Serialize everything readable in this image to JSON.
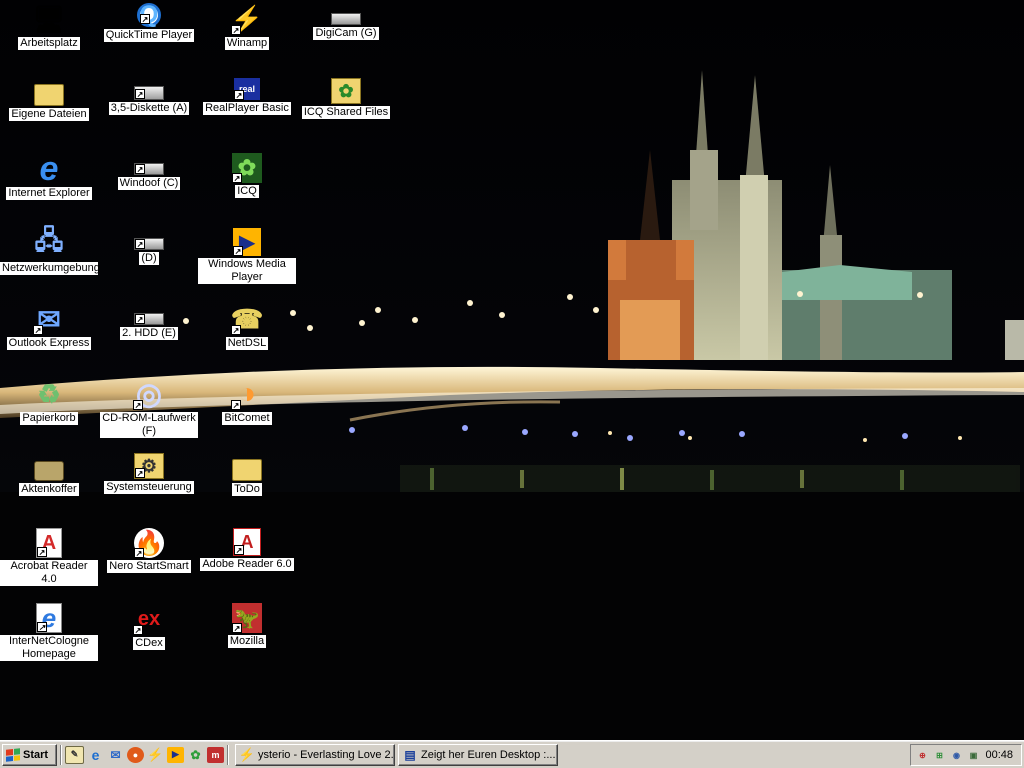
{
  "desktop": {
    "icons": [
      {
        "label": "Arbeitsplatz",
        "icon": "my-computer-icon",
        "shortcut": false
      },
      {
        "label": "QuickTime Player",
        "icon": "quicktime-icon",
        "shortcut": true
      },
      {
        "label": "Winamp",
        "icon": "winamp-icon",
        "shortcut": true
      },
      {
        "label": "DigiCam (G)",
        "icon": "drive-icon",
        "shortcut": false
      },
      {
        "label": "Eigene Dateien",
        "icon": "folder-icon",
        "shortcut": false
      },
      {
        "label": "3,5-Diskette (A)",
        "icon": "floppy-icon",
        "shortcut": true
      },
      {
        "label": "RealPlayer Basic",
        "icon": "realplayer-icon",
        "shortcut": true
      },
      {
        "label": "ICQ Shared Files",
        "icon": "folder-flower-icon",
        "shortcut": false
      },
      {
        "label": "Internet Explorer",
        "icon": "internet-explorer-icon",
        "shortcut": false
      },
      {
        "label": "Windoof (C)",
        "icon": "drive-icon",
        "shortcut": true
      },
      {
        "label": "ICQ",
        "icon": "icq-icon",
        "shortcut": true
      },
      {
        "label": "Netzwerkumgebung",
        "icon": "network-icon",
        "shortcut": false
      },
      {
        "label": "(D)",
        "icon": "drive-icon",
        "shortcut": true
      },
      {
        "label": "Windows Media Player",
        "icon": "media-player-icon",
        "shortcut": true
      },
      {
        "label": "Outlook Express",
        "icon": "outlook-icon",
        "shortcut": true
      },
      {
        "label": "2. HDD (E)",
        "icon": "drive-icon",
        "shortcut": true
      },
      {
        "label": "NetDSL",
        "icon": "phone-icon",
        "shortcut": true
      },
      {
        "label": "Papierkorb",
        "icon": "recycle-bin-icon",
        "shortcut": false
      },
      {
        "label": "CD-ROM-Laufwerk (F)",
        "icon": "cd-icon",
        "shortcut": true
      },
      {
        "label": "BitComet",
        "icon": "bitcomet-icon",
        "shortcut": true
      },
      {
        "label": "Aktenkoffer",
        "icon": "briefcase-icon",
        "shortcut": false
      },
      {
        "label": "Systemsteuerung",
        "icon": "control-panel-icon",
        "shortcut": true
      },
      {
        "label": "ToDo",
        "icon": "folder-icon",
        "shortcut": false
      },
      {
        "label": "Acrobat Reader 4.0",
        "icon": "acrobat-icon",
        "shortcut": true
      },
      {
        "label": "Nero StartSmart",
        "icon": "nero-icon",
        "shortcut": true
      },
      {
        "label": "Adobe Reader 6.0",
        "icon": "adobe-reader-icon",
        "shortcut": true
      },
      {
        "label": "InterNetCologne Homepage",
        "icon": "ie-link-icon",
        "shortcut": true
      },
      {
        "label": "CDex",
        "icon": "cdex-icon",
        "shortcut": true
      },
      {
        "label": "Mozilla",
        "icon": "mozilla-icon",
        "shortcut": true
      }
    ]
  },
  "taskbar": {
    "start_label": "Start",
    "quick_launch": [
      "show-desktop-icon",
      "internet-explorer-icon",
      "outlook-icon",
      "nero-icon",
      "winamp-icon",
      "media-player-icon",
      "icq-icon",
      "mozilla-icon"
    ],
    "tasks": [
      {
        "label": "ysterio - Everlasting Love 2...",
        "icon": "winamp-icon",
        "active": false
      },
      {
        "label": "Zeigt her Euren Desktop :...",
        "icon": "browser-window-icon",
        "active": false
      }
    ],
    "tray_icons": [
      "connection-icon",
      "network-tray-icon",
      "speaker-icon",
      "display-icon"
    ],
    "clock": "00:48"
  },
  "colors": {
    "label_bg": "#ffffff",
    "taskbar_bg": "#d4d0c8",
    "desktop_bg": "#020204"
  }
}
